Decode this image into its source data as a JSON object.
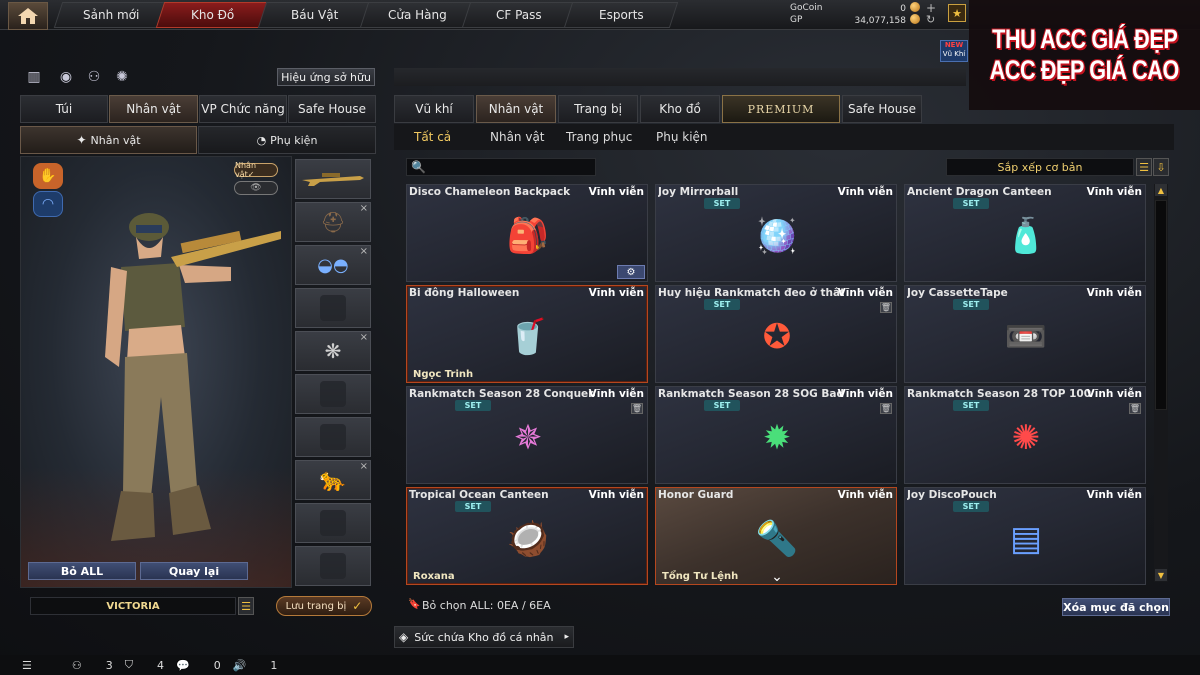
{
  "nav": {
    "tabs": [
      {
        "label": "Sảnh mới",
        "active": false
      },
      {
        "label": "Kho Đồ",
        "active": true
      },
      {
        "label": "Báu Vật",
        "active": false
      },
      {
        "label": "Cửa Hàng",
        "active": false
      },
      {
        "label": "CF Pass",
        "active": false
      },
      {
        "label": "Esports",
        "active": false
      }
    ],
    "gocoin_label": "GoCoin",
    "gocoin_value": "0",
    "gp_label": "GP",
    "gp_value": "34,077,158"
  },
  "banner": {
    "line1": "THU ACC GIÁ ĐẸP",
    "line2": "ACC ĐẸP GIÁ CAO",
    "badge_new": "NEW",
    "badge_text": "Vũ Khí"
  },
  "left": {
    "effect_button": "Hiệu ứng sở hữu",
    "tabs": [
      {
        "label": "Túi",
        "active": false
      },
      {
        "label": "Nhân vật",
        "active": true
      },
      {
        "label": "VP Chức năng",
        "active": false
      },
      {
        "label": "Safe House",
        "active": false
      }
    ],
    "subtabs": [
      {
        "label": "Nhân vật",
        "active": true
      },
      {
        "label": "Phụ kiện",
        "active": false
      }
    ],
    "npc_tag": "Nhân vật✓",
    "bo_all": "Bỏ ALL",
    "quay_lai": "Quay lại",
    "character_name": "VICTORIA",
    "save_button": "Lưu trang bị"
  },
  "inventory": {
    "tabs": [
      {
        "label": "Vũ khí",
        "active": false
      },
      {
        "label": "Nhân vật",
        "active": true
      },
      {
        "label": "Trang bị",
        "active": false
      },
      {
        "label": "Kho đồ",
        "active": false
      },
      {
        "label": "PREMIUM",
        "active": false
      },
      {
        "label": "Safe House",
        "active": false
      }
    ],
    "filters": [
      {
        "label": "Tất cả",
        "active": true
      },
      {
        "label": "Nhân vật",
        "active": false
      },
      {
        "label": "Trang phục",
        "active": false
      },
      {
        "label": "Phụ kiện",
        "active": false
      }
    ],
    "sort_label": "Sắp xếp cơ bản",
    "items": [
      {
        "name": "Disco Chameleon Backpack",
        "duration": "Vĩnh viễn",
        "set": "",
        "owner": "",
        "icon": "backpack-icon",
        "style": "normal",
        "trash": false,
        "gear": true
      },
      {
        "name": "Joy Mirrorball",
        "duration": "Vĩnh viễn",
        "set": "SET",
        "owner": "",
        "icon": "mirrorball-icon",
        "style": "normal",
        "trash": false,
        "gear": false
      },
      {
        "name": "Ancient Dragon Canteen",
        "duration": "Vĩnh viễn",
        "set": "SET",
        "owner": "",
        "icon": "canteen-icon",
        "style": "normal",
        "trash": false,
        "gear": false
      },
      {
        "name": "Bi đông Halloween",
        "duration": "Vĩnh viễn",
        "set": "",
        "owner": "Ngọc Trinh",
        "icon": "halloween-canteen-icon",
        "style": "red",
        "trash": false,
        "gear": false
      },
      {
        "name": "Huy hiệu Rankmatch đeo ở thắt lưng",
        "duration": "Vĩnh viễn",
        "set": "SET",
        "owner": "",
        "icon": "rank-badge-icon",
        "style": "normal",
        "trash": true,
        "gear": false
      },
      {
        "name": "Joy CassetteTape",
        "duration": "Vĩnh viễn",
        "set": "SET",
        "owner": "",
        "icon": "cassette-icon",
        "style": "normal",
        "trash": false,
        "gear": false
      },
      {
        "name": "Rankmatch Season 28 Conqueror Badge",
        "duration": "Vĩnh viễn",
        "set": "SET",
        "owner": "",
        "icon": "conqueror-badge-icon",
        "style": "normal",
        "trash": true,
        "gear": false
      },
      {
        "name": "Rankmatch Season 28 SOG Badge",
        "duration": "Vĩnh viễn",
        "set": "SET",
        "owner": "",
        "icon": "sog-badge-icon",
        "style": "normal",
        "trash": true,
        "gear": false
      },
      {
        "name": "Rankmatch Season 28 TOP 100 Badge",
        "duration": "Vĩnh viễn",
        "set": "SET",
        "owner": "",
        "icon": "top100-badge-icon",
        "style": "normal",
        "trash": true,
        "gear": false
      },
      {
        "name": "Tropical Ocean Canteen",
        "duration": "Vĩnh viễn",
        "set": "SET",
        "owner": "Roxana",
        "icon": "coconut-canteen-icon",
        "style": "red",
        "trash": false,
        "gear": false
      },
      {
        "name": "Honor Guard",
        "duration": "Vĩnh viễn",
        "set": "",
        "owner": "Tổng Tư Lệnh",
        "icon": "honor-guard-icon",
        "style": "brown",
        "trash": false,
        "gear": false
      },
      {
        "name": "Joy DiscoPouch",
        "duration": "Vĩnh viễn",
        "set": "SET",
        "owner": "",
        "icon": "disco-pouch-icon",
        "style": "normal",
        "trash": false,
        "gear": false
      }
    ],
    "deselect_text": "Bỏ chọn ALL: 0EA / 6EA",
    "clear_button": "Xóa mục đã chọn",
    "capacity_label": "Sức chứa Kho đồ cá nhân"
  },
  "status": {
    "friends_count": "3",
    "clan_count": "4",
    "chat_count": "0",
    "sound_count": "1"
  },
  "colors": {
    "accent_red": "#8a1c1c",
    "gold": "#f0c040",
    "card_border_red": "#b5471f",
    "set_badge": "#21535c"
  }
}
